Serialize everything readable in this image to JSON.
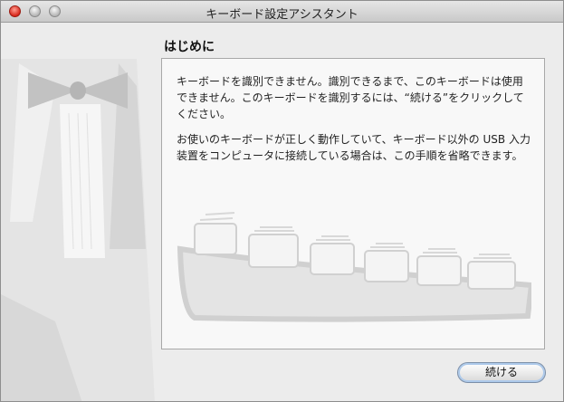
{
  "window": {
    "title": "キーボード設定アシスタント"
  },
  "page": {
    "heading": "はじめに",
    "paragraph1": "キーボードを識別できません。識別できるまで、このキーボードは使用できません。このキーボードを識別するには、“続ける”をクリックしてください。",
    "paragraph2": "お使いのキーボードが正しく動作していて、キーボード以外の USB 入力装置をコンピュータに接続している場合は、この手順を省略できます。"
  },
  "buttons": {
    "continue": "続ける"
  },
  "icons": {
    "background": "tuxedo-illustration-icon",
    "keyboard": "keyboard-illustration-icon"
  }
}
